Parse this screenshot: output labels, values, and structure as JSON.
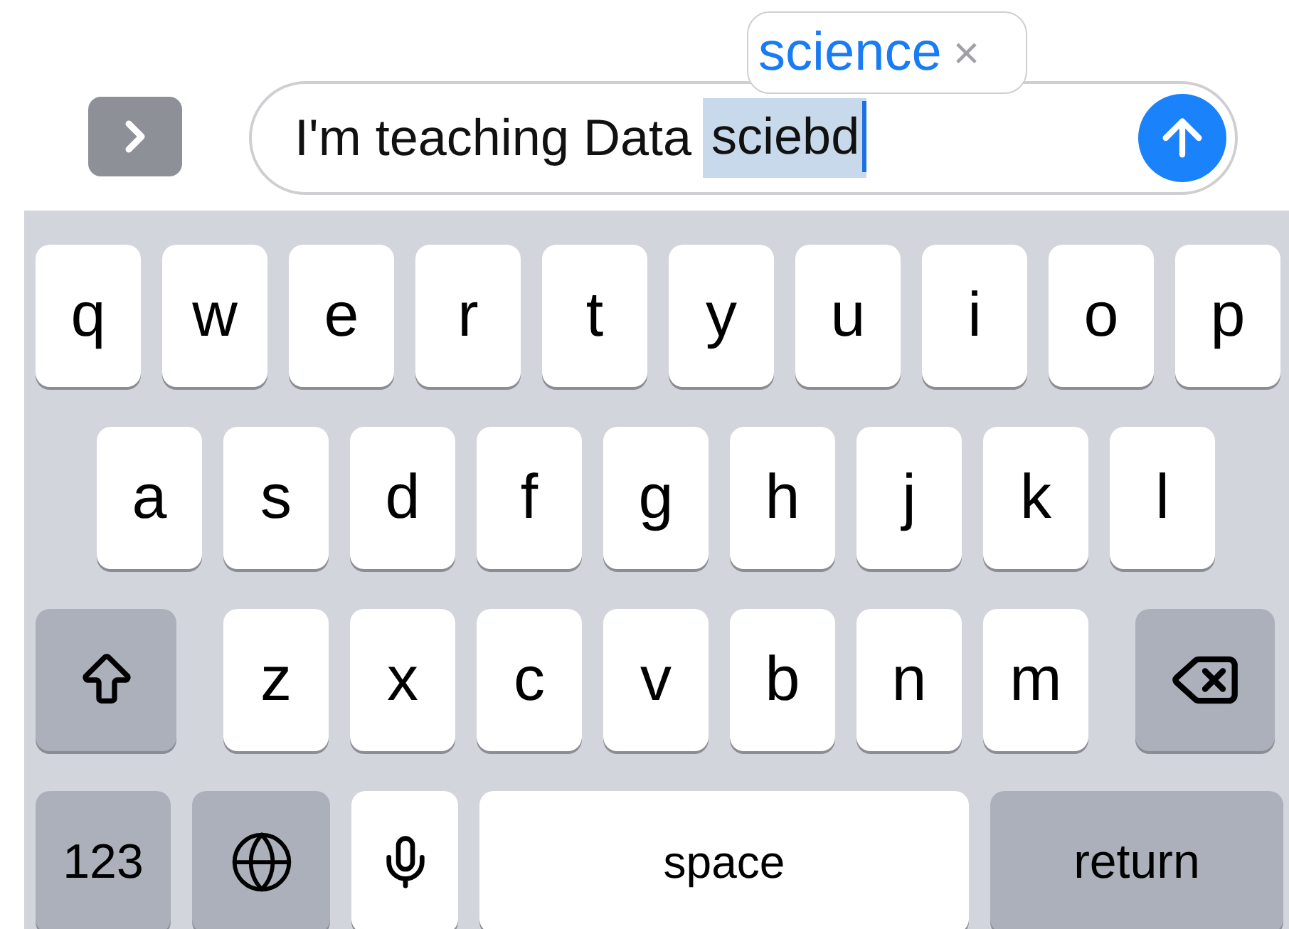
{
  "message_field": {
    "text": "I'm teaching Data",
    "misspelled_word": "sciebd"
  },
  "autocorrect": {
    "suggestion": "science",
    "dismiss": "×"
  },
  "keyboard": {
    "rows": [
      {
        "keys": [
          {
            "kind": "letter",
            "label": "q"
          },
          {
            "kind": "letter",
            "label": "w"
          },
          {
            "kind": "letter",
            "label": "e"
          },
          {
            "kind": "letter",
            "label": "r"
          },
          {
            "kind": "letter",
            "label": "t"
          },
          {
            "kind": "letter",
            "label": "y"
          },
          {
            "kind": "letter",
            "label": "u"
          },
          {
            "kind": "letter",
            "label": "i"
          },
          {
            "kind": "letter",
            "label": "o"
          },
          {
            "kind": "letter",
            "label": "p"
          }
        ]
      },
      {
        "keys": [
          {
            "kind": "letter",
            "label": "a"
          },
          {
            "kind": "letter",
            "label": "s"
          },
          {
            "kind": "letter",
            "label": "d"
          },
          {
            "kind": "letter",
            "label": "f"
          },
          {
            "kind": "letter",
            "label": "g"
          },
          {
            "kind": "letter",
            "label": "h"
          },
          {
            "kind": "letter",
            "label": "j"
          },
          {
            "kind": "letter",
            "label": "k"
          },
          {
            "kind": "letter",
            "label": "l"
          }
        ]
      },
      {
        "keys": [
          {
            "kind": "shift"
          },
          {
            "kind": "letter",
            "label": "z"
          },
          {
            "kind": "letter",
            "label": "x"
          },
          {
            "kind": "letter",
            "label": "c"
          },
          {
            "kind": "letter",
            "label": "v"
          },
          {
            "kind": "letter",
            "label": "b"
          },
          {
            "kind": "letter",
            "label": "n"
          },
          {
            "kind": "letter",
            "label": "m"
          },
          {
            "kind": "delete"
          }
        ]
      },
      {
        "keys": [
          {
            "kind": "numbers",
            "label": "123"
          },
          {
            "kind": "globe"
          },
          {
            "kind": "mic"
          },
          {
            "kind": "space",
            "label": "space"
          },
          {
            "kind": "return",
            "label": "return"
          }
        ]
      }
    ]
  }
}
